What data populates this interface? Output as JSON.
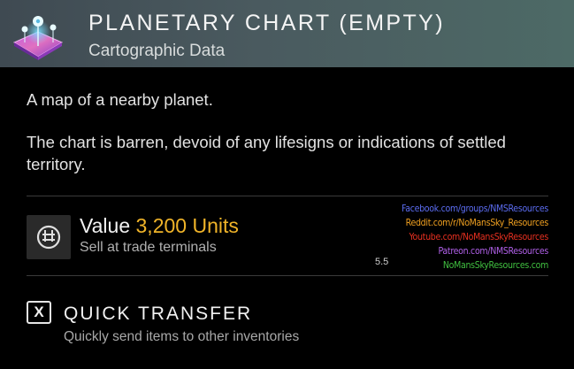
{
  "item": {
    "title": "PLANETARY CHART (EMPTY)",
    "category": "Cartographic Data",
    "icon": "planetary-chart-icon"
  },
  "description": {
    "line1": "A map of a nearby planet.",
    "line2": "The chart is barren, devoid of any lifesigns or indications of settled territory."
  },
  "value": {
    "label": "Value",
    "amount": "3,200 Units",
    "subtext": "Sell at trade terminals",
    "icon": "units-currency-icon",
    "amount_color": "#f0b429"
  },
  "watermark": {
    "lines": [
      {
        "text": "Facebook.com/groups/NMSResources",
        "color": "#5b6cf0"
      },
      {
        "text": "Reddit.com/r/NoMansSky_Resources",
        "color": "#f0a020"
      },
      {
        "text": "Youtube.com/NoMansSkyResources",
        "color": "#e83020"
      },
      {
        "text": "Patreon.com/NMSResources",
        "color": "#b060e8"
      },
      {
        "text": "NoMansSkyResources.com",
        "color": "#40c040"
      }
    ],
    "version": "5.5"
  },
  "quick_transfer": {
    "key": "X",
    "title": "QUICK TRANSFER",
    "subtext": "Quickly send items to other inventories"
  }
}
